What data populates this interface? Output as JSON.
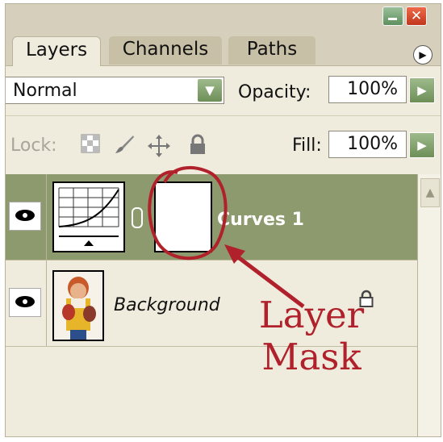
{
  "panel": {
    "tabs": [
      {
        "label": "Layers",
        "active": true
      },
      {
        "label": "Channels",
        "active": false
      },
      {
        "label": "Paths",
        "active": false
      }
    ],
    "menu_icon": "▶",
    "close_icon": "✕"
  },
  "blend": {
    "mode": "Normal",
    "arrow_icon": "▼"
  },
  "opacity": {
    "label": "Opacity:",
    "value": "100%",
    "arrow_icon": "▶"
  },
  "lock": {
    "label": "Lock:"
  },
  "fill": {
    "label": "Fill:",
    "value": "100%",
    "arrow_icon": "▶"
  },
  "layers": [
    {
      "name": "Curves 1",
      "type": "adjustment",
      "selected": true,
      "has_mask": true
    },
    {
      "name": "Background",
      "type": "image",
      "selected": false,
      "locked": true
    }
  ],
  "scrollbar": {
    "up_icon": "▲"
  },
  "annotation": {
    "line1": "Layer",
    "line2": "Mask",
    "color": "#b0212c"
  },
  "colors": {
    "selected_row": "#8d9a6d",
    "panel_bg": "#efecdd",
    "green_button": "#7f9d6b"
  }
}
